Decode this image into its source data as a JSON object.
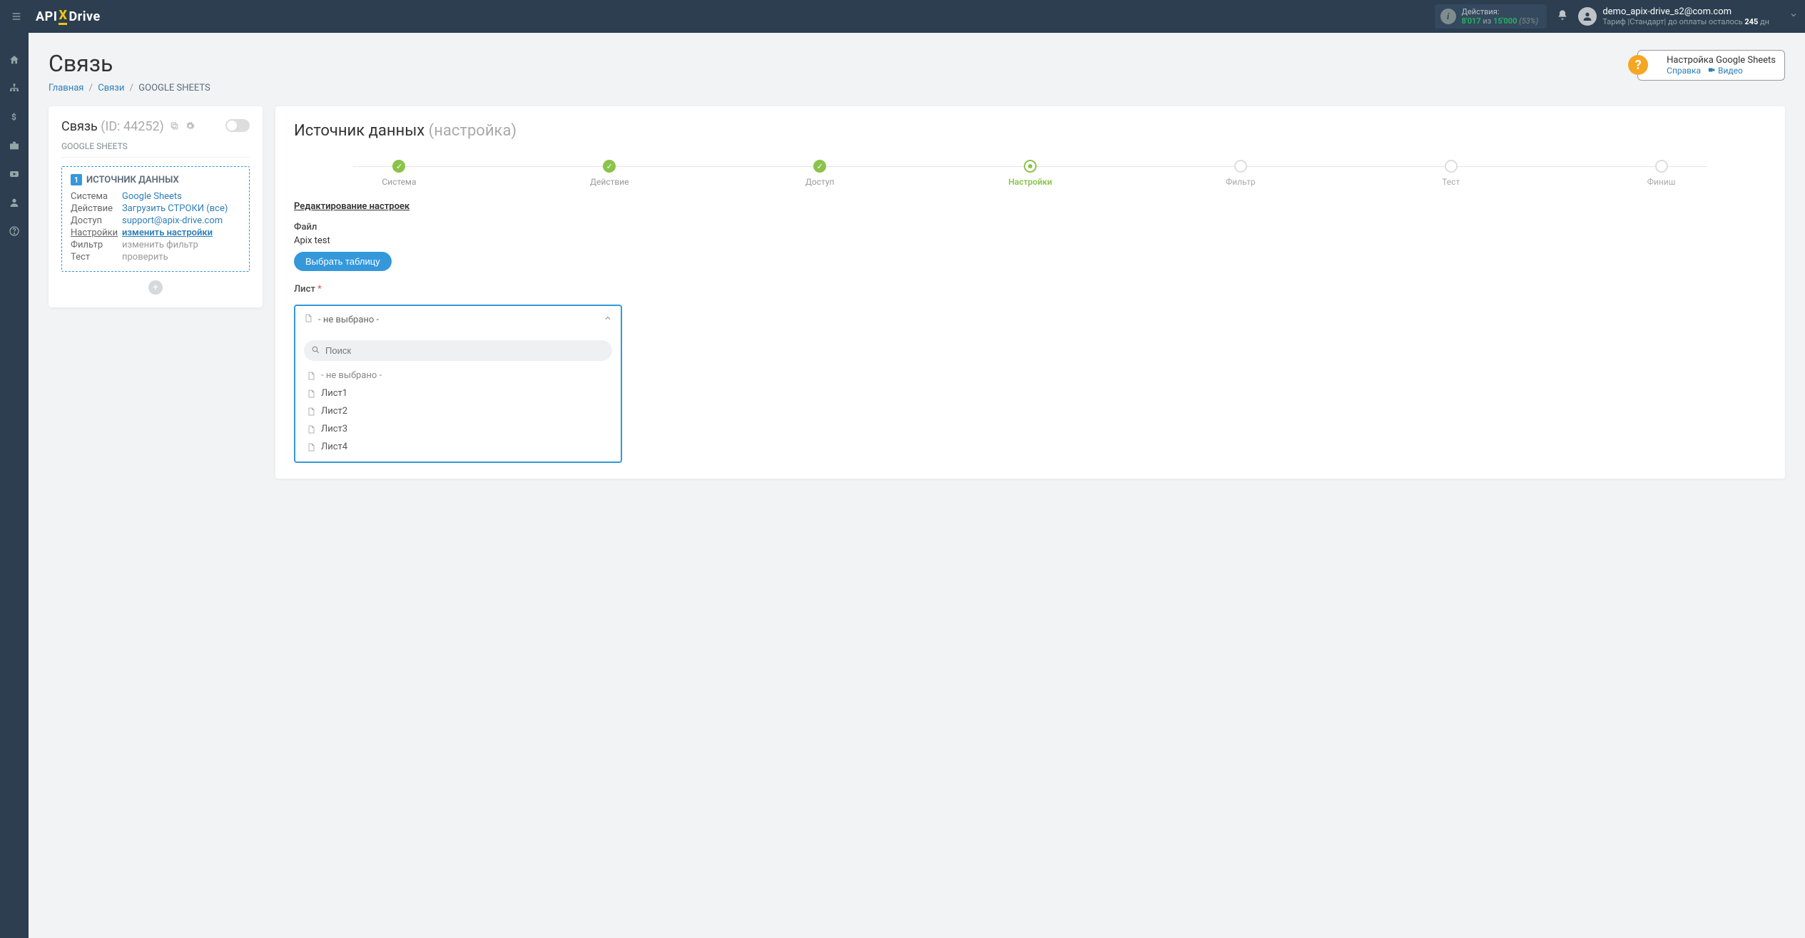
{
  "brand": {
    "part1": "API",
    "x": "X",
    "part2": "Drive"
  },
  "nav": {
    "actions_label": "Действия:",
    "actions_used": "8'017",
    "actions_of_word": "из",
    "actions_total": "15'000",
    "actions_pct": "(53%)",
    "user_email": "demo_apix-drive_s2@com.com",
    "tariff_prefix": "Тариф |Стандарт| до оплаты осталось ",
    "tariff_days": "245",
    "tariff_suffix": " дн"
  },
  "page": {
    "title": "Связь",
    "breadcrumb": {
      "home": "Главная",
      "links": "Связи",
      "current": "GOOGLE SHEETS"
    },
    "help": {
      "title": "Настройка Google Sheets",
      "ref": "Справка",
      "video": "Видео"
    }
  },
  "leftcard": {
    "title": "Связь",
    "id_label": "(ID: 44252)",
    "subtitle": "GOOGLE SHEETS",
    "box_header": "ИСТОЧНИК ДАННЫХ",
    "rows": [
      {
        "k": "Система",
        "v": "Google Sheets",
        "link": true
      },
      {
        "k": "Действие",
        "v": "Загрузить СТРОКИ (все)",
        "link": true
      },
      {
        "k": "Доступ",
        "v": "support@apix-drive.com",
        "link": true
      },
      {
        "k": "Настройки",
        "v": "изменить настройки",
        "link": true,
        "underline": true,
        "k_underline": true
      },
      {
        "k": "Фильтр",
        "v": "изменить фильтр",
        "link": false
      },
      {
        "k": "Тест",
        "v": "проверить",
        "link": false
      }
    ]
  },
  "rightcard": {
    "title": "Источник данных",
    "title_sub": "(настройка)",
    "steps": [
      "Система",
      "Действие",
      "Доступ",
      "Настройки",
      "Фильтр",
      "Тест",
      "Финиш"
    ],
    "section_header": "Редактирование настроек",
    "file_label": "Файл",
    "file_value": "Apix test",
    "choose_btn": "Выбрать таблицу",
    "sheet_label": "Лист",
    "select_placeholder": "- не выбрано -",
    "search_placeholder": "Поиск",
    "options": [
      "- не выбрано -",
      "Лист1",
      "Лист2",
      "Лист3",
      "Лист4"
    ]
  }
}
